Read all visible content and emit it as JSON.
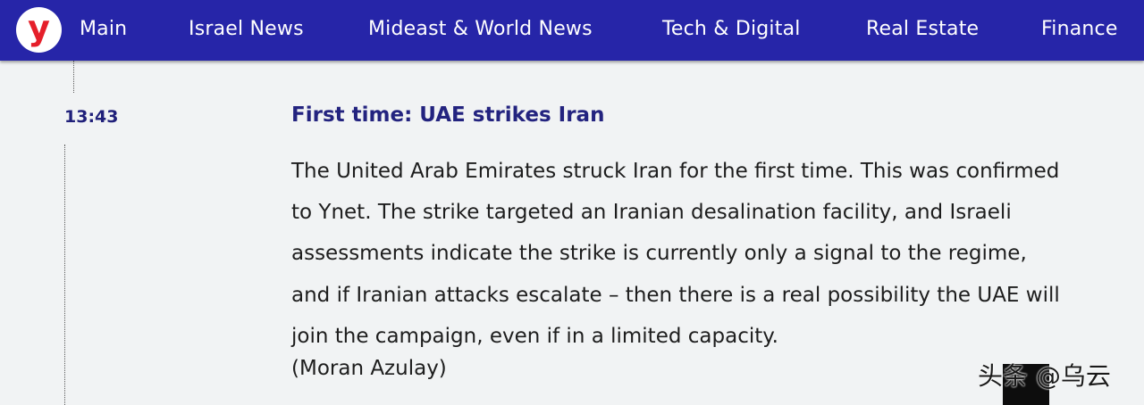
{
  "brand": {
    "logo_letter": "y",
    "logo_color": "#e51f2a",
    "nav_color": "#2625a8"
  },
  "nav": {
    "items": [
      "Main",
      "Israel News",
      "Mideast & World News",
      "Tech & Digital",
      "Real Estate",
      "Finance"
    ]
  },
  "article": {
    "time": "13:43",
    "headline": "First time: UAE strikes Iran",
    "body_lines": [
      "The United Arab Emirates struck Iran for the first time. This was confirmed",
      "to Ynet. The strike targeted an Iranian desalination facility, and Israeli",
      "assessments indicate the strike is currently only a signal to the regime,",
      "and if Iranian attacks escalate – then there is a real possibility the UAE will",
      "join the campaign, even if in a limited capacity."
    ],
    "byline": "(Moran Azulay)"
  },
  "watermark": {
    "text": "头条 @乌云"
  }
}
